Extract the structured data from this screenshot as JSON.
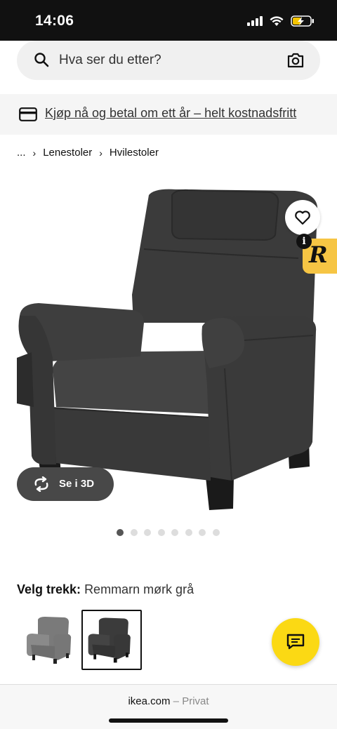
{
  "status_bar": {
    "time": "14:06"
  },
  "search": {
    "placeholder": "Hva ser du etter?"
  },
  "promo": {
    "text": "Kjøp nå og betal om ett år – helt kostnadsfritt"
  },
  "breadcrumb": {
    "ellipsis": "...",
    "items": [
      "Lenestoler",
      "Hvilestoler"
    ]
  },
  "product": {
    "view_3d_label": "Se i 3D",
    "image_count": 8,
    "active_image": 1
  },
  "variant": {
    "label": "Velg trekk:",
    "value": "Remmarn mørk grå",
    "options_count": 2,
    "selected_index": 1
  },
  "extension_badge": {
    "info": "i",
    "letter": "R"
  },
  "browser": {
    "domain": "ikea.com",
    "separator": " – ",
    "mode": "Privat"
  },
  "colors": {
    "accent_yellow": "#fbd914",
    "badge_yellow": "#f6c544",
    "chair_dark": "#3b3b3b",
    "chair_light": "#7a7a7a"
  }
}
